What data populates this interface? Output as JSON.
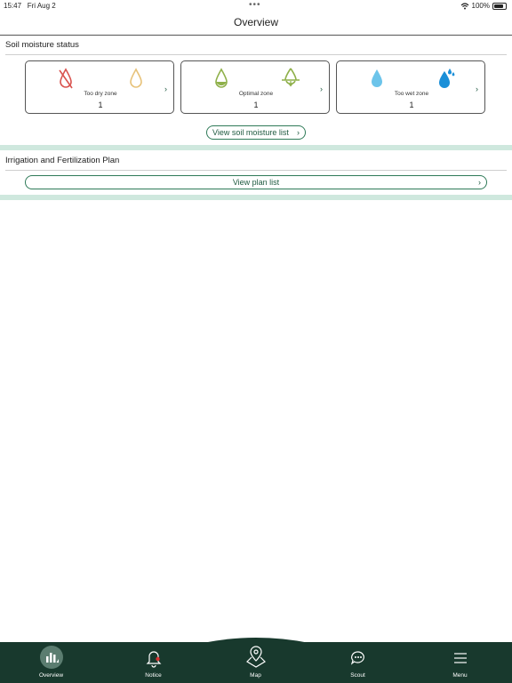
{
  "status": {
    "time": "15:47",
    "date": "Fri Aug 2",
    "battery": "100%"
  },
  "header": {
    "title": "Overview"
  },
  "soil": {
    "title": "Soil moisture status",
    "cards": [
      {
        "label": "Too dry zone",
        "count": "1"
      },
      {
        "label": "Optimal zone",
        "count": "1"
      },
      {
        "label": "Too wet zone",
        "count": "1"
      }
    ],
    "view_button": "View soil moisture list"
  },
  "plan": {
    "title": "Irrigation and Fertilization Plan",
    "view_button": "View plan list"
  },
  "tabs": [
    {
      "label": "Overview",
      "icon": "overview-icon"
    },
    {
      "label": "Notice",
      "icon": "bell-icon"
    },
    {
      "label": "Map",
      "icon": "map-pin-icon"
    },
    {
      "label": "Scout",
      "icon": "chat-icon"
    },
    {
      "label": "Menu",
      "icon": "menu-icon"
    }
  ],
  "colors": {
    "accent": "#2f7a58",
    "tabbar": "#18392d",
    "band": "#cfe8de",
    "dry": "#d9534f",
    "dry_light": "#e7c27a",
    "optimal": "#8fb04a",
    "wet_light": "#6cc4ea",
    "wet": "#1a8fd8"
  }
}
